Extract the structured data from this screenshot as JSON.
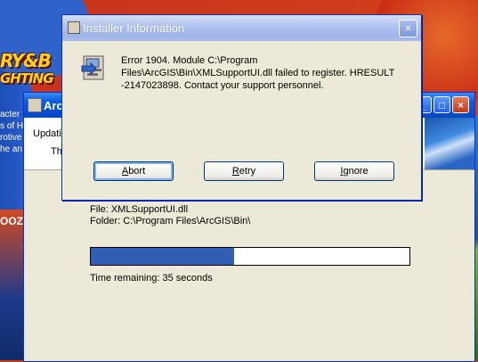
{
  "background": {
    "logo_line1": "RY&B",
    "logo_line2": "GHTING",
    "text_lines": [
      "acter",
      "s of H",
      "rotive",
      "he an"
    ],
    "bottom_text": "OOZ"
  },
  "back_window": {
    "title": "ArcG",
    "updating": "Updatin",
    "th": "Th",
    "file_line": "File: XMLSupportUI.dll",
    "folder_line": "Folder: C:\\Program Files\\ArcGIS\\Bin\\",
    "progress_fraction": 0.45,
    "time_remaining": "Time remaining: 35 seconds",
    "controls": {
      "minimize": "_",
      "maximize": "□",
      "close": "×"
    }
  },
  "dialog": {
    "title": "Installer Information",
    "close_glyph": "×",
    "message": "Error 1904. Module C:\\Program Files\\ArcGIS\\Bin\\XMLSupportUI.dll failed to register.  HRESULT -2147023898.  Contact your support personnel.",
    "buttons": {
      "abort": {
        "pre": "",
        "key": "A",
        "post": "bort"
      },
      "retry": {
        "pre": "",
        "key": "R",
        "post": "etry"
      },
      "ignore": {
        "pre": "",
        "key": "I",
        "post": "gnore"
      }
    }
  },
  "icons": [
    "installer-icon",
    "close-icon",
    "minimize-icon",
    "maximize-icon"
  ],
  "colors": {
    "progress_fill": "#2f5eb3",
    "title_active": "#0a5ddf",
    "title_inactive": "#b1c3ee"
  }
}
